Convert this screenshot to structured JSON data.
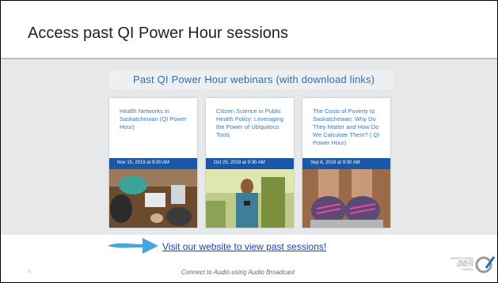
{
  "slide": {
    "title": "Access past QI Power Hour sessions",
    "page_number": "5",
    "footer": "Connect to Audio using Audio Broadcast"
  },
  "webinars": {
    "heading": "Past QI Power Hour webinars (with download links)",
    "cards": [
      {
        "title": "Health Networks in Saskatchewan (QI Power Hour)",
        "date": "Nov 15, 2019 at 9:30 AM"
      },
      {
        "title": "Citizen Science in Public Health Policy: Leveraging the Power of Ubiquitous Tools",
        "date": "Oct 25, 2019 at 9:30 AM"
      },
      {
        "title": "The Costs of Poverty to Saskatchewan: Why Do They Matter and How Do We Calculate Them? ( QI Power Hour)",
        "date": "Sep 6, 2019 at 9:30 AM"
      }
    ]
  },
  "link": {
    "text": "Visit our website to view past sessions!"
  },
  "logo": {
    "line1": "SASKATCHEWAN",
    "line2": "HEALTH",
    "line3": "QUALITY",
    "line4": "COUNCIL"
  },
  "colors": {
    "accent_blue": "#1a57a8",
    "link_blue": "#1a3fbf",
    "arrow_blue": "#4aa3de"
  }
}
